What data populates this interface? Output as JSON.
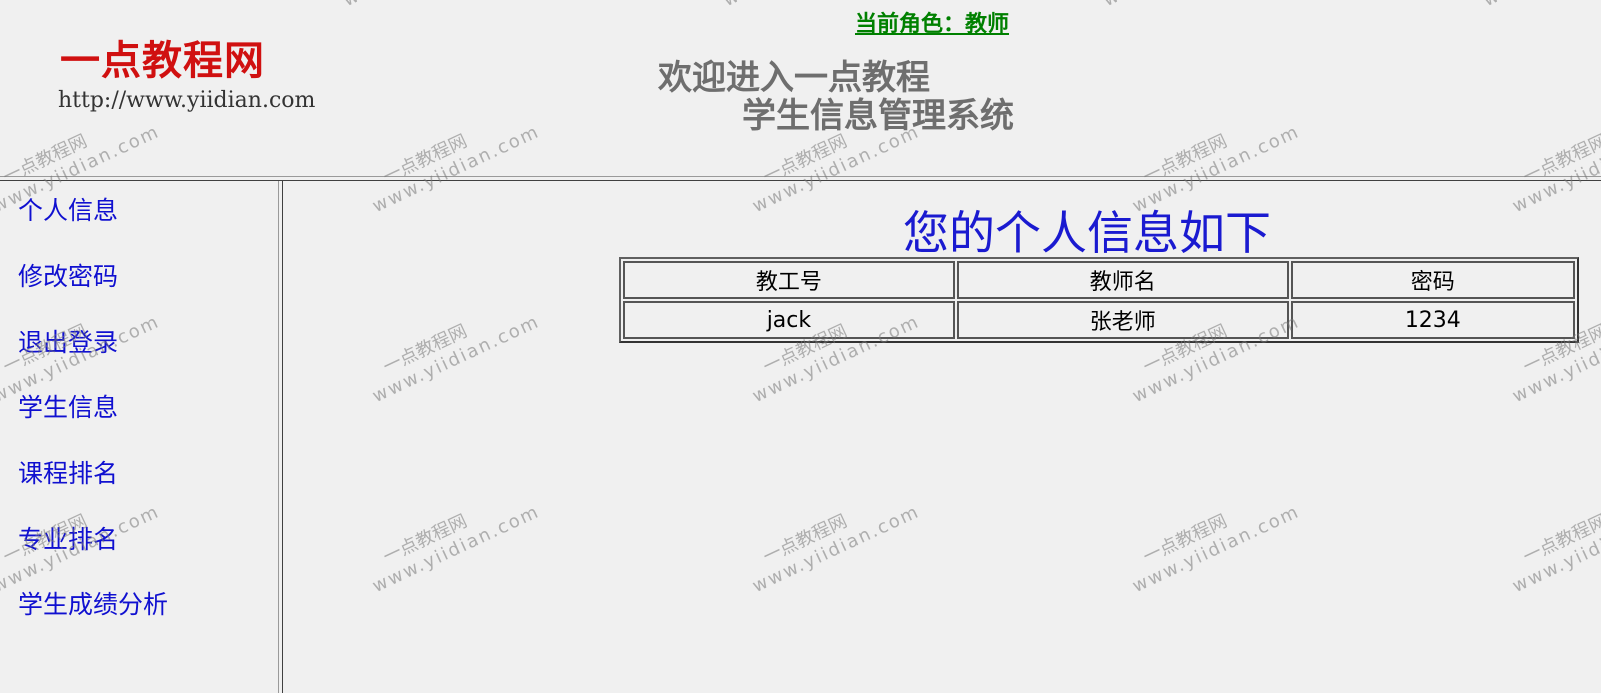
{
  "header": {
    "logo_text": "一点教程网",
    "logo_url": "http://www.yiidian.com",
    "welcome_line1": "欢迎进入一点教程",
    "welcome_line2": "学生信息管理系统",
    "current_role": "当前角色：教师"
  },
  "nav": {
    "items": [
      {
        "label": "个人信息"
      },
      {
        "label": "修改密码"
      },
      {
        "label": "退出登录"
      },
      {
        "label": "学生信息"
      },
      {
        "label": "课程排名"
      },
      {
        "label": "专业排名"
      },
      {
        "label": "学生成绩分析"
      }
    ]
  },
  "main": {
    "title": "您的个人信息如下",
    "table": {
      "headers": [
        "教工号",
        "教师名",
        "密码"
      ],
      "rows": [
        [
          "jack",
          "张老师",
          "1234"
        ]
      ]
    }
  },
  "watermark": {
    "line1": "一点教程网",
    "line2": "www.yiidian.com"
  },
  "colors": {
    "logo": "#d01010",
    "role": "#008000",
    "nav_link": "#1010d0",
    "title": "#1a1ad0"
  }
}
